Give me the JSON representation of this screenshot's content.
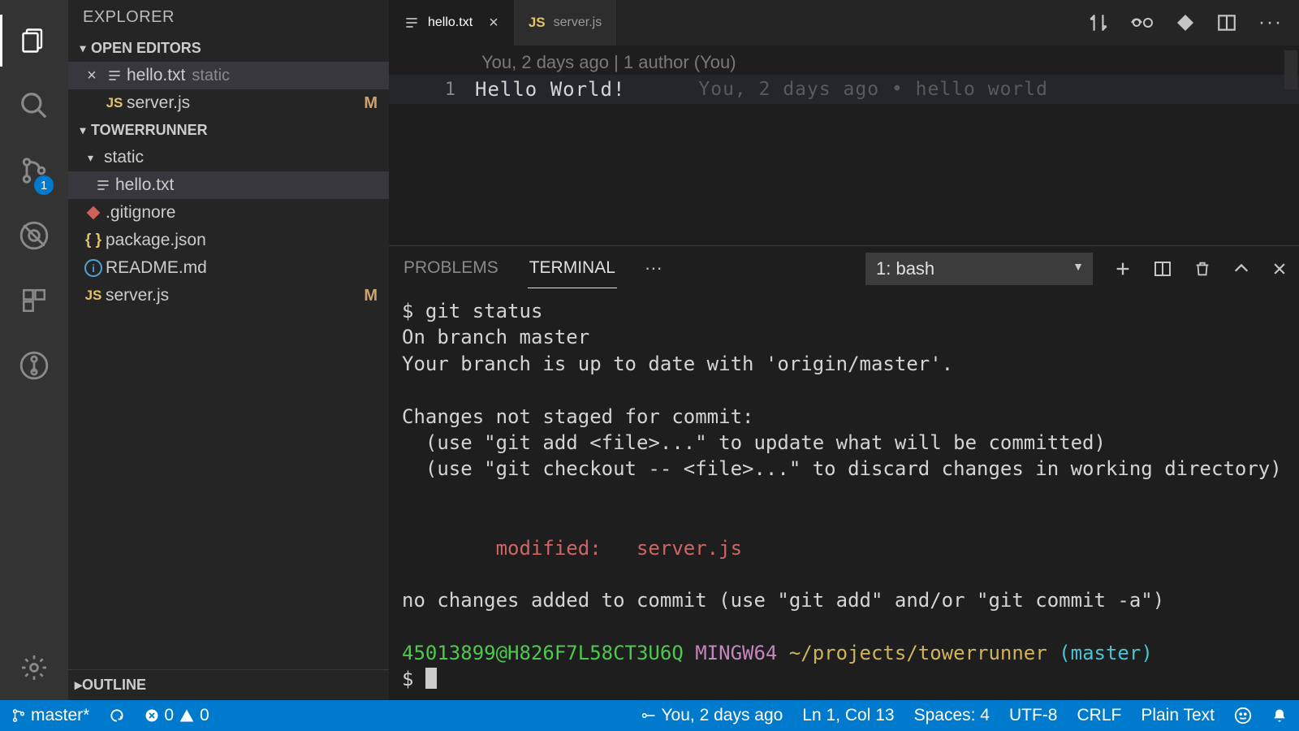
{
  "sidebar": {
    "title": "EXPLORER",
    "badge_scm": "1",
    "open_editors": {
      "label": "OPEN EDITORS",
      "items": [
        {
          "name": "hello.txt",
          "suffix": "static",
          "active": true,
          "kind": "lines"
        },
        {
          "name": "server.js",
          "suffix": "",
          "active": false,
          "kind": "js",
          "modified": "M"
        }
      ]
    },
    "workspace": {
      "label": "TOWERRUNNER",
      "folder": "static",
      "files": [
        {
          "name": "hello.txt",
          "kind": "lines",
          "selected": true
        },
        {
          "name": ".gitignore",
          "kind": "git"
        },
        {
          "name": "package.json",
          "kind": "braces"
        },
        {
          "name": "README.md",
          "kind": "info"
        },
        {
          "name": "server.js",
          "kind": "js",
          "modified": "M"
        }
      ]
    },
    "outline": "OUTLINE"
  },
  "tabs": [
    {
      "name": "hello.txt",
      "kind": "lines",
      "active": true
    },
    {
      "name": "server.js",
      "kind": "js",
      "active": false
    }
  ],
  "editor": {
    "codelens": "You, 2 days ago | 1 author (You)",
    "line_number": "1",
    "content": "Hello World!",
    "blame": "You, 2 days ago • hello world"
  },
  "panel": {
    "tabs": {
      "problems": "PROBLEMS",
      "terminal": "TERMINAL"
    },
    "select": "1: bash",
    "lines": {
      "l1": "$ git status",
      "l2": "On branch master",
      "l3": "Your branch is up to date with 'origin/master'.",
      "l4": "",
      "l5": "Changes not staged for commit:",
      "l6": "  (use \"git add <file>...\" to update what will be committed)",
      "l7": "  (use \"git checkout -- <file>...\" to discard changes in working directory)",
      "l8": "",
      "l9": "",
      "l10_red": "        modified:   server.js",
      "l11": "",
      "l12": "no changes added to commit (use \"git add\" and/or \"git commit -a\")",
      "l13": "",
      "prompt_user": "45013899@H826F7L58CT3U6Q",
      "prompt_sys": " MINGW64",
      "prompt_path": " ~/projects/towerrunner",
      "prompt_branch": " (master)",
      "prompt_dollar": "$ "
    }
  },
  "status": {
    "branch": "master*",
    "errors": "0",
    "warnings": "0",
    "blame": "You, 2 days ago",
    "position": "Ln 1, Col 13",
    "spaces": "Spaces: 4",
    "encoding": "UTF-8",
    "eol": "CRLF",
    "language": "Plain Text"
  }
}
